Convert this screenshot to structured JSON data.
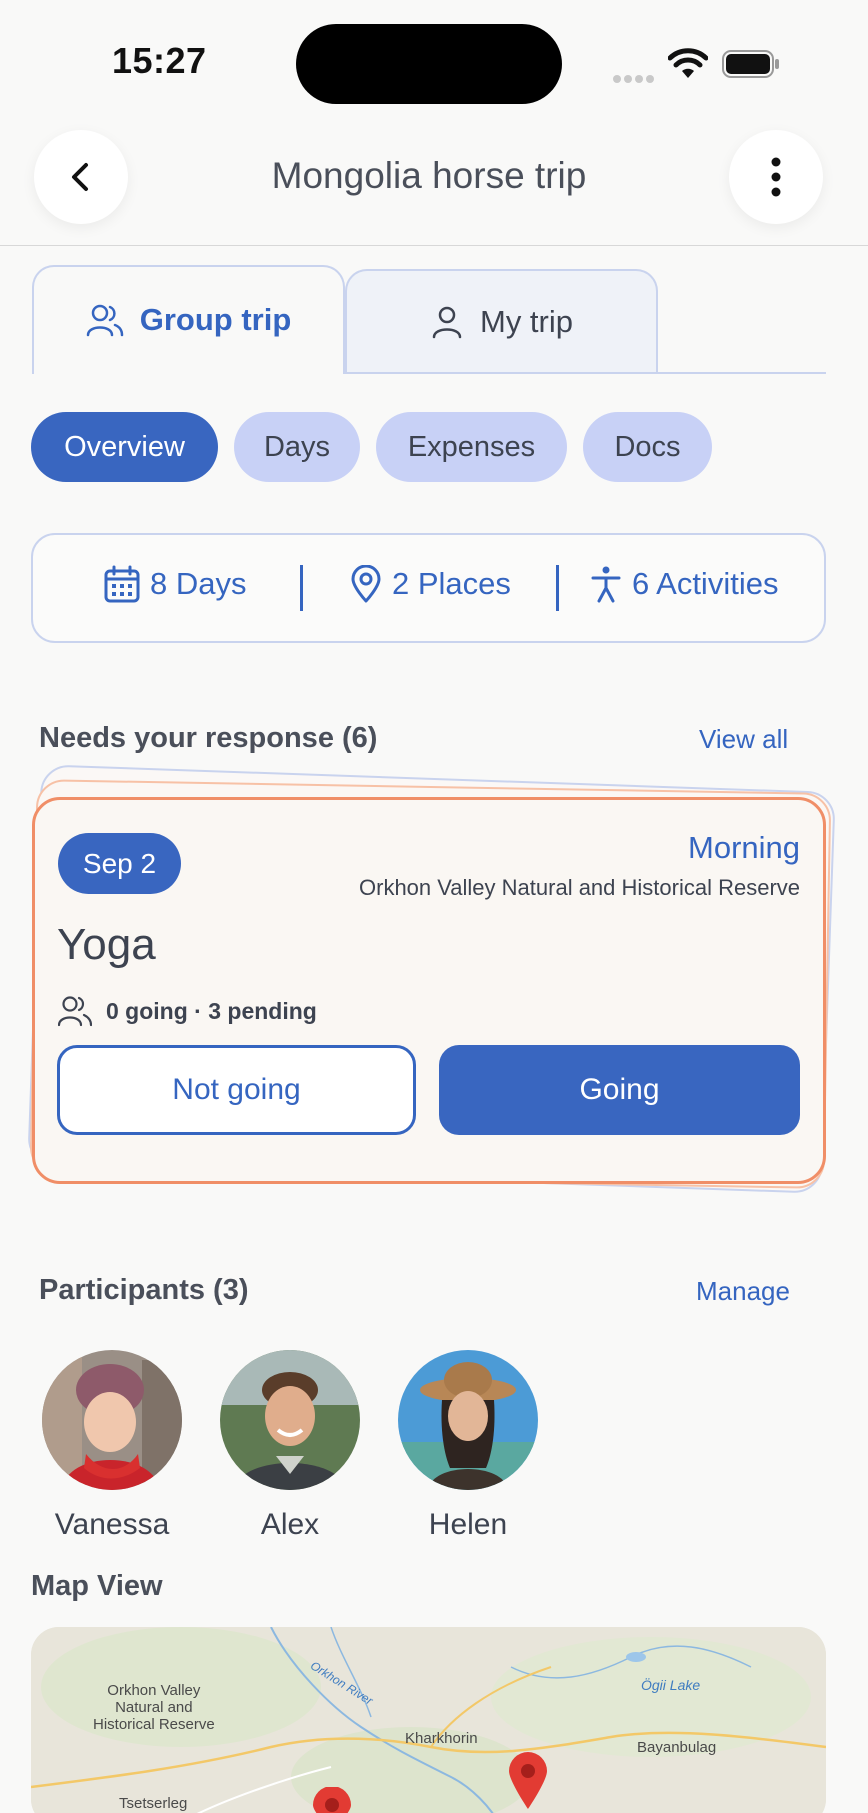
{
  "status_bar": {
    "time": "15:27"
  },
  "header": {
    "title": "Mongolia horse trip",
    "back_icon": "chevron-left-icon",
    "menu_icon": "more-vertical-icon"
  },
  "tabs": [
    {
      "label": "Group trip",
      "icon": "group-icon",
      "active": true
    },
    {
      "label": "My trip",
      "icon": "user-icon",
      "active": false
    }
  ],
  "pills": [
    {
      "label": "Overview",
      "active": true
    },
    {
      "label": "Days",
      "active": false
    },
    {
      "label": "Expenses",
      "active": false
    },
    {
      "label": "Docs",
      "active": false
    }
  ],
  "stats": {
    "days": "8 Days",
    "places": "2 Places",
    "activities": "6 Activities"
  },
  "needs_response": {
    "title": "Needs your response (6)",
    "link": "View all",
    "card": {
      "date": "Sep 2",
      "time_of_day": "Morning",
      "place": "Orkhon Valley Natural and Historical Reserve",
      "activity": "Yoga",
      "counts": "0 going · 3 pending",
      "not_going_label": "Not going",
      "going_label": "Going"
    }
  },
  "participants": {
    "title": "Participants (3)",
    "link": "Manage",
    "people": [
      {
        "name": "Vanessa"
      },
      {
        "name": "Alex"
      },
      {
        "name": "Helen"
      }
    ]
  },
  "map": {
    "title": "Map View",
    "labels": {
      "orkhon": "Orkhon Valley\nNatural and\nHistorical Reserve",
      "river": "Orkhon River",
      "ogii": "Ögii Lake",
      "kharkhorin": "Kharkhorin",
      "bayanbulag": "Bayanbulag",
      "tsetserleg": "Tsetserleg"
    }
  },
  "colors": {
    "accent": "#3966c0",
    "highlight": "#f08e67",
    "pill_bg": "#c8d1f6"
  }
}
